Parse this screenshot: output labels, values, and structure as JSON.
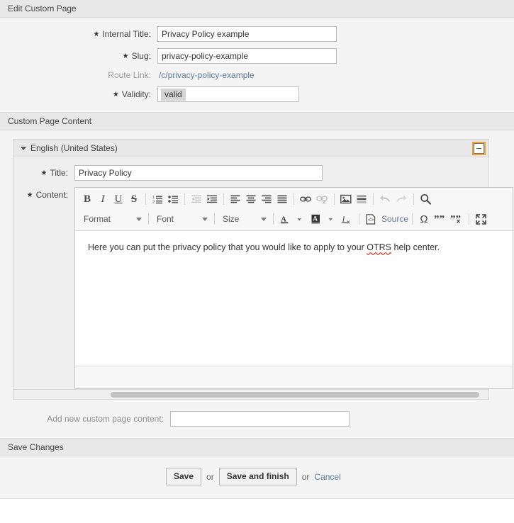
{
  "edit_panel": {
    "header_title": "Edit Custom Page",
    "fields": {
      "internal_title": {
        "label": "Internal Title:",
        "required_marker": "★",
        "value": "Privacy Policy example",
        "placeholder": ""
      },
      "slug": {
        "label": "Slug:",
        "required_marker": "★",
        "value": "privacy-policy-example",
        "placeholder": ""
      },
      "route_link": {
        "label": "Route Link:",
        "value": "/c/privacy-policy-example"
      },
      "validity": {
        "label": "Validity:",
        "required_marker": "★",
        "selected": "valid"
      }
    }
  },
  "content_panel": {
    "header_title": "Custom Page Content",
    "language_section": {
      "title": "English (United States)",
      "collapse_icon": "minus-box-icon",
      "expand_caret": "caret-down-icon"
    },
    "title_field": {
      "label": "Title:",
      "required_marker": "★",
      "value": "Privacy Policy",
      "placeholder": ""
    },
    "content_field": {
      "label": "Content:",
      "required_marker": "★",
      "body_text_before": "Here you can put the privacy policy that you would like to apply to your ",
      "body_misspelled_word": "OTRS",
      "body_text_after": " help center."
    },
    "editor_toolbar": {
      "row1": [
        {
          "name": "bold-icon",
          "label": "B",
          "disabled": false
        },
        {
          "name": "italic-icon",
          "label": "I",
          "disabled": false
        },
        {
          "name": "underline-icon",
          "label": "U",
          "disabled": false
        },
        {
          "name": "strikethrough-icon",
          "label": "S",
          "disabled": false
        },
        {
          "name": "numbered-list-icon",
          "label": "",
          "disabled": false
        },
        {
          "name": "bulleted-list-icon",
          "label": "",
          "disabled": false
        },
        {
          "name": "outdent-icon",
          "label": "",
          "disabled": true
        },
        {
          "name": "indent-icon",
          "label": "",
          "disabled": false
        },
        {
          "name": "align-left-icon",
          "label": "",
          "disabled": false
        },
        {
          "name": "align-center-icon",
          "label": "",
          "disabled": false
        },
        {
          "name": "align-right-icon",
          "label": "",
          "disabled": false
        },
        {
          "name": "align-justify-icon",
          "label": "",
          "disabled": false
        },
        {
          "name": "link-icon",
          "label": "",
          "disabled": false
        },
        {
          "name": "unlink-icon",
          "label": "",
          "disabled": true
        },
        {
          "name": "image-icon",
          "label": "",
          "disabled": false
        },
        {
          "name": "horizontal-rule-icon",
          "label": "",
          "disabled": false
        },
        {
          "name": "undo-icon",
          "label": "",
          "disabled": true
        },
        {
          "name": "redo-icon",
          "label": "",
          "disabled": true
        },
        {
          "name": "find-icon",
          "label": "",
          "disabled": false
        }
      ],
      "row2": {
        "format_combo": "Format",
        "font_combo": "Font",
        "size_combo": "Size",
        "text_color": "text-color-icon",
        "background_color": "background-color-icon",
        "remove_format": "remove-format-icon",
        "source_label": "Source",
        "special_char": "Ω",
        "blockquote": "blockquote-icon",
        "remove_blockquote": "remove-blockquote-icon",
        "maximize": "maximize-icon"
      }
    },
    "add_new": {
      "label": "Add new custom page content:",
      "value": "",
      "placeholder": ""
    }
  },
  "save_panel": {
    "header_title": "Save Changes",
    "save_label": "Save",
    "or_label_1": "or",
    "save_and_finish_label": "Save and finish",
    "or_label_2": "or",
    "cancel_label": "Cancel"
  },
  "colors": {
    "panel_header_bg": "#e8e8e8",
    "panel_body_bg": "#f4f4f4",
    "link": "#5c7a99",
    "focus_outline": "#e8a33d",
    "spellcheck": "#e23b2e",
    "chip_bg": "#d4d4d4"
  }
}
